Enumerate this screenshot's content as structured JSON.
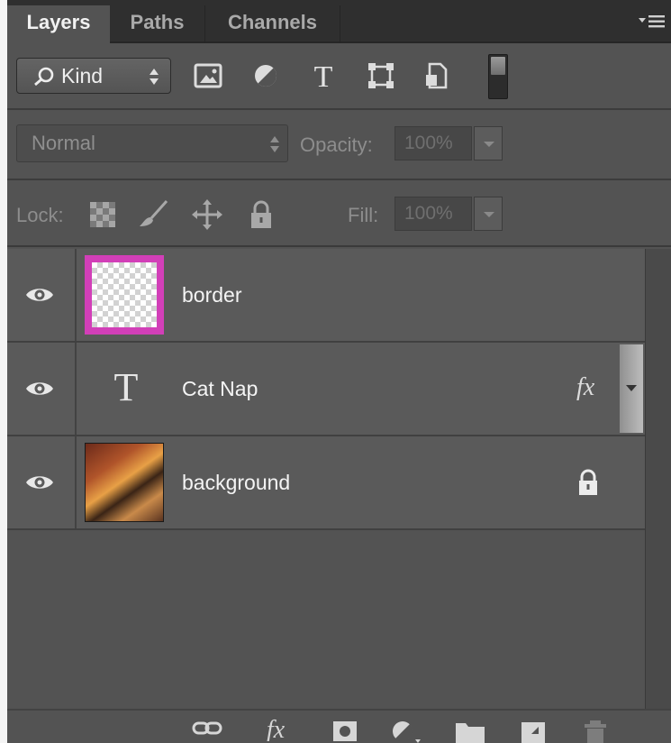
{
  "tabs": [
    {
      "label": "Layers",
      "active": true
    },
    {
      "label": "Paths",
      "active": false
    },
    {
      "label": "Channels",
      "active": false
    }
  ],
  "filter": {
    "kind_label": "Kind",
    "icons": [
      "pixel-filter-icon",
      "adjustment-filter-icon",
      "type-filter-icon",
      "shape-filter-icon",
      "smart-object-filter-icon"
    ]
  },
  "blend": {
    "mode": "Normal",
    "opacity_label": "Opacity:",
    "opacity_value": "100%"
  },
  "lock": {
    "label": "Lock:",
    "fill_label": "Fill:",
    "fill_value": "100%"
  },
  "layers": [
    {
      "name": "border",
      "visible": true,
      "thumbnail": "transparent-with-magenta-border"
    },
    {
      "name": "Cat Nap",
      "visible": true,
      "type": "text",
      "has_effects": true,
      "fx_label": "fx"
    },
    {
      "name": "background",
      "visible": true,
      "thumbnail": "photo",
      "locked": true
    }
  ],
  "bottom_icons": [
    "link-layers-icon",
    "layer-style-icon",
    "layer-mask-icon",
    "adjustment-layer-icon",
    "new-group-icon",
    "new-layer-icon",
    "delete-layer-icon"
  ],
  "colors": {
    "panel": "#535353",
    "tab_bar": "#2f2f2f",
    "layer_row": "#5a5a5a",
    "border_thumb": "#d23fb8"
  }
}
